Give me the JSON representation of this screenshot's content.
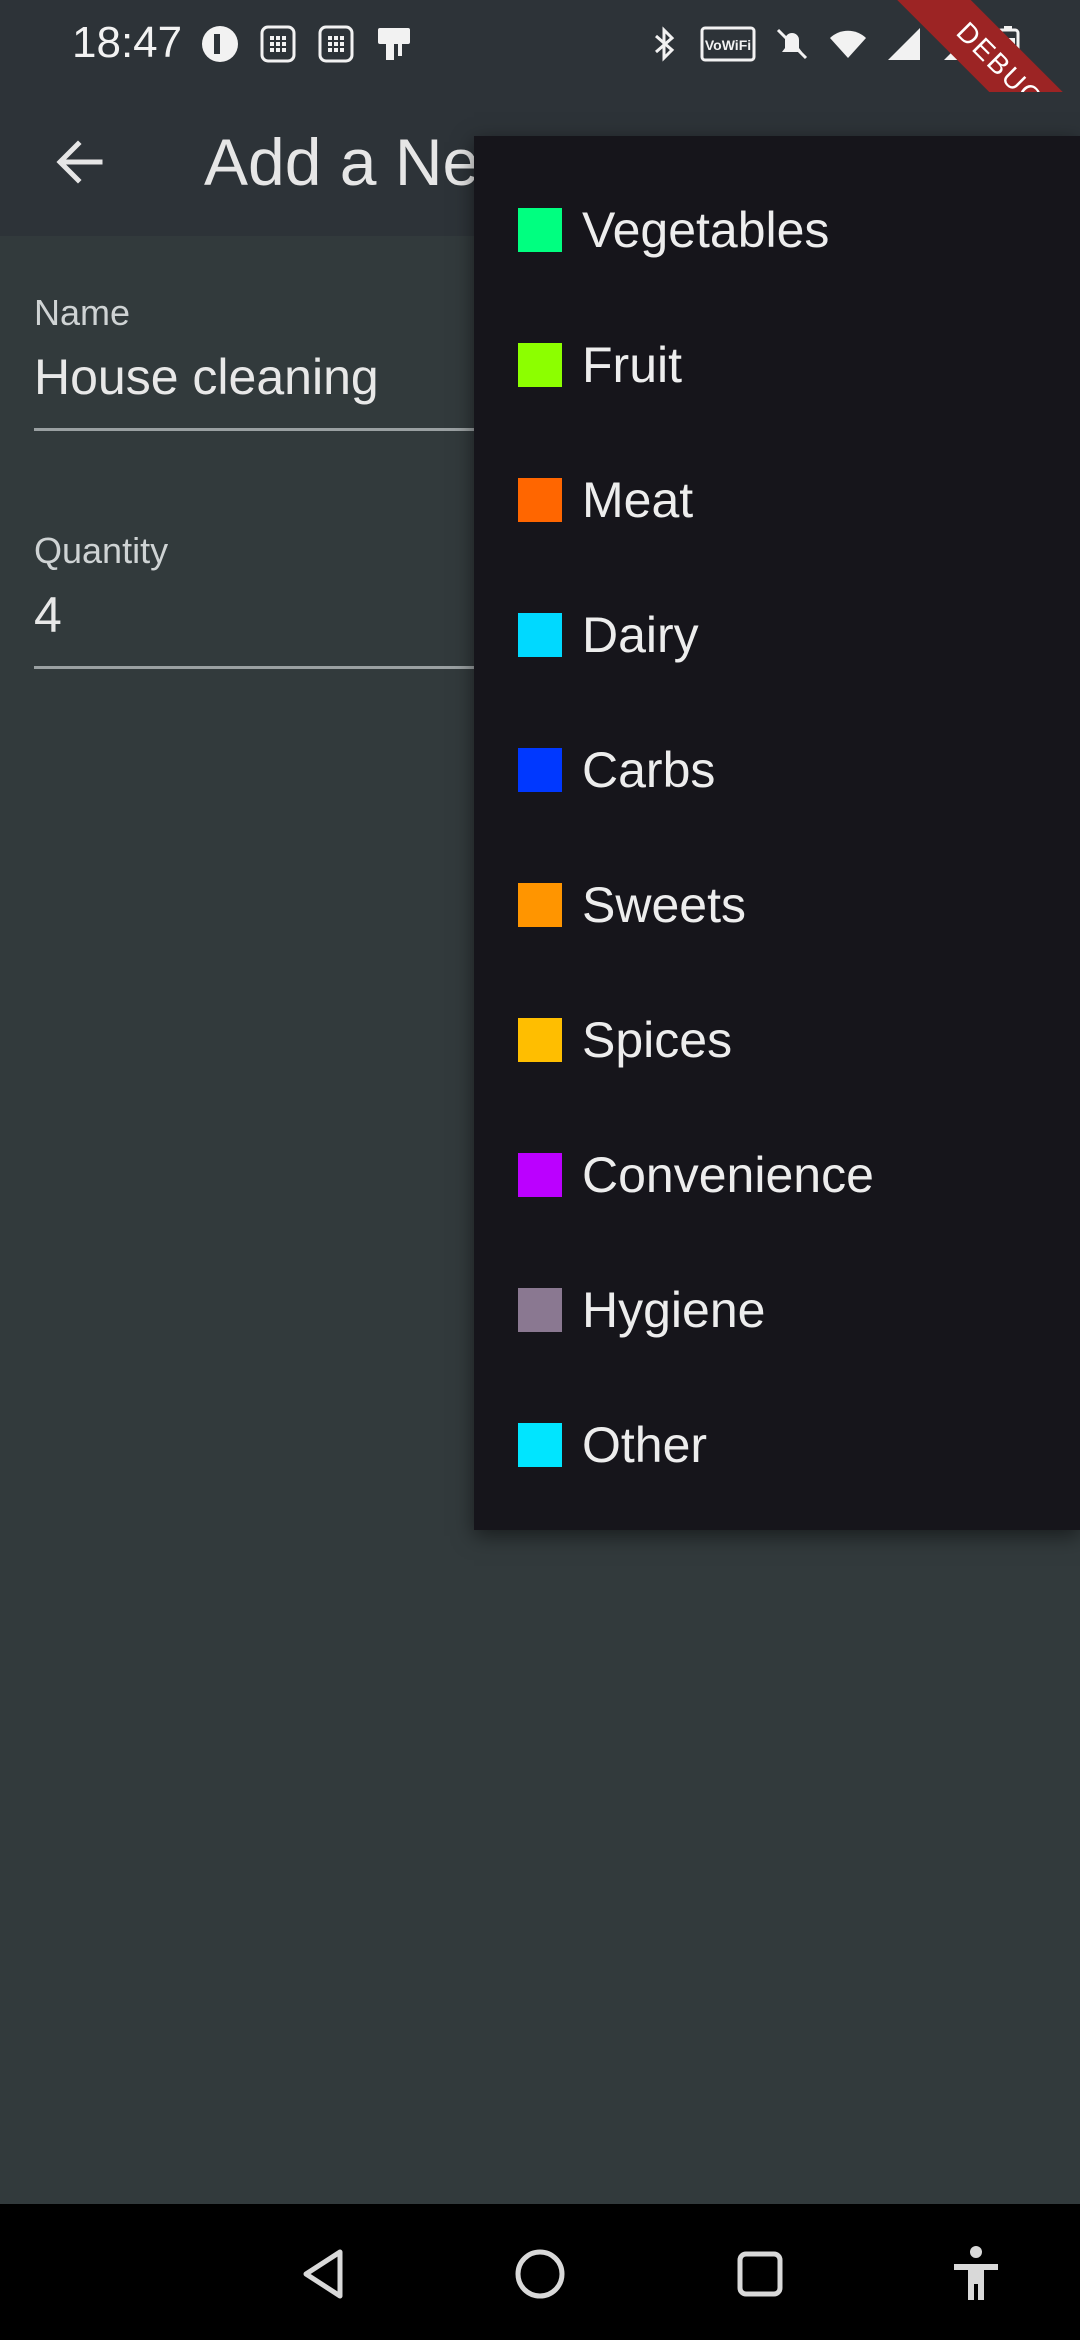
{
  "status": {
    "time": "18:47",
    "left_icons": [
      "app-icon-p",
      "sim-icon",
      "sim-icon",
      "device-icon"
    ],
    "right_icons": [
      "bluetooth-icon",
      "vowifi-icon",
      "mute-icon",
      "wifi-icon",
      "signal-icon",
      "signal-icon",
      "battery-icon"
    ],
    "wifi_label": "VoWiFi",
    "debug": "DEBUG"
  },
  "appbar": {
    "title": "Add a New Item"
  },
  "form": {
    "name_label": "Name",
    "name_value": "House cleaning",
    "quantity_label": "Quantity",
    "quantity_value": "4"
  },
  "menu": {
    "items": [
      {
        "label": "Vegetables",
        "color": "#00ff80"
      },
      {
        "label": "Fruit",
        "color": "#8cff00"
      },
      {
        "label": "Meat",
        "color": "#ff6600"
      },
      {
        "label": "Dairy",
        "color": "#00d9ff"
      },
      {
        "label": "Carbs",
        "color": "#0038ff"
      },
      {
        "label": "Sweets",
        "color": "#ff9500"
      },
      {
        "label": "Spices",
        "color": "#ffbe00"
      },
      {
        "label": "Convenience",
        "color": "#bb00ff"
      },
      {
        "label": "Hygiene",
        "color": "#8a7891"
      },
      {
        "label": "Other",
        "color": "#00e5ff"
      }
    ]
  },
  "navbar": {
    "buttons": [
      "back-triangle-icon",
      "home-circle-icon",
      "recents-square-icon",
      "accessibility-icon"
    ]
  }
}
